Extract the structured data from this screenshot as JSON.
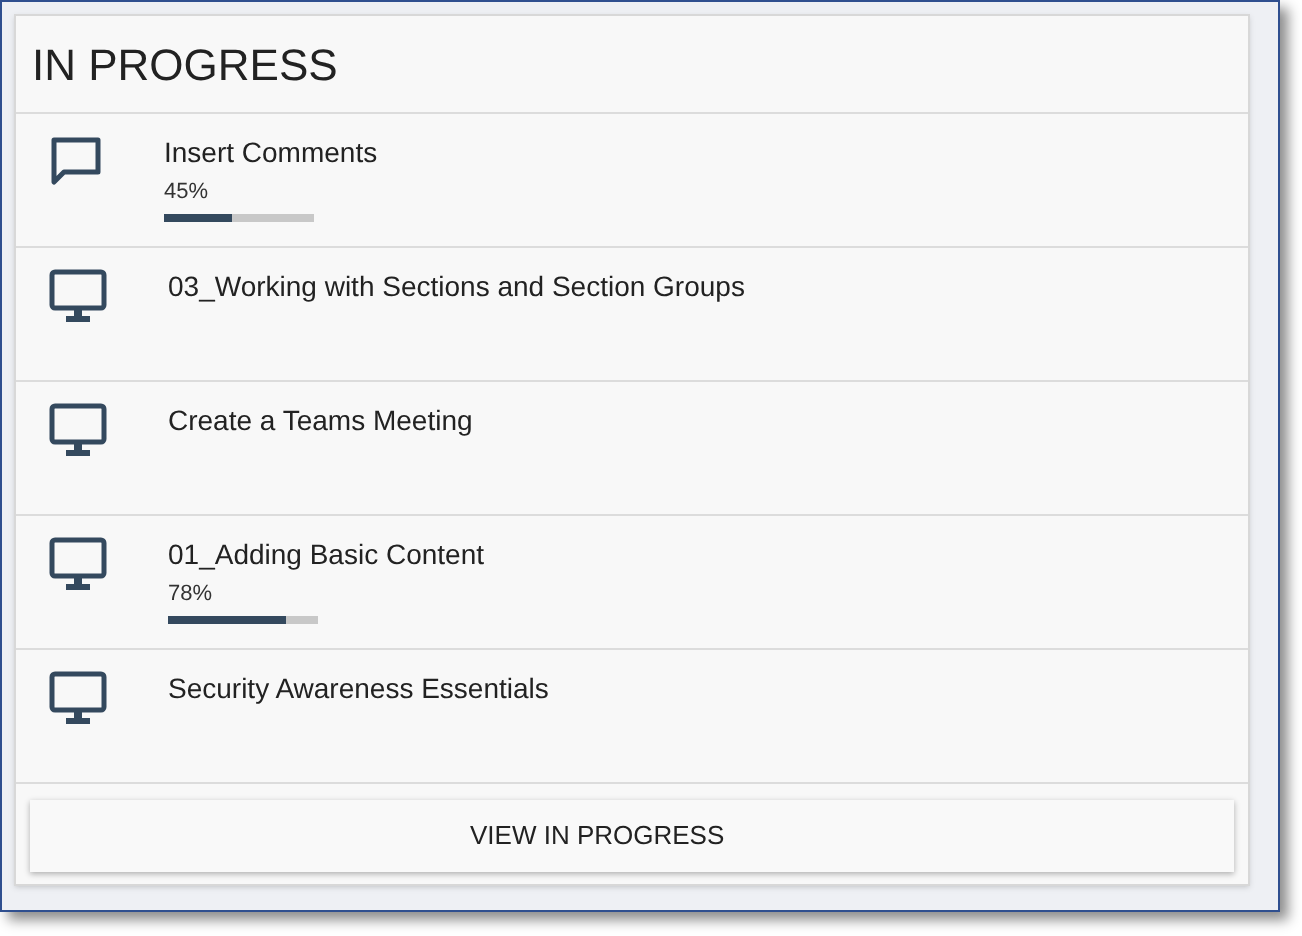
{
  "title": "IN PROGRESS",
  "items": [
    {
      "kind": "comment",
      "name": "Insert Comments",
      "percent": "45%",
      "level": 0.45
    },
    {
      "kind": "monitor",
      "name": "03_Working with Sections and Section Groups"
    },
    {
      "kind": "monitor",
      "name": "Create a Teams Meeting"
    },
    {
      "kind": "monitor",
      "name": "01_Adding Basic Content",
      "percent": "78%",
      "level": 0.78
    },
    {
      "kind": "monitor",
      "name": "Security Awareness Essentials"
    }
  ],
  "button": "VIEW IN PROGRESS"
}
